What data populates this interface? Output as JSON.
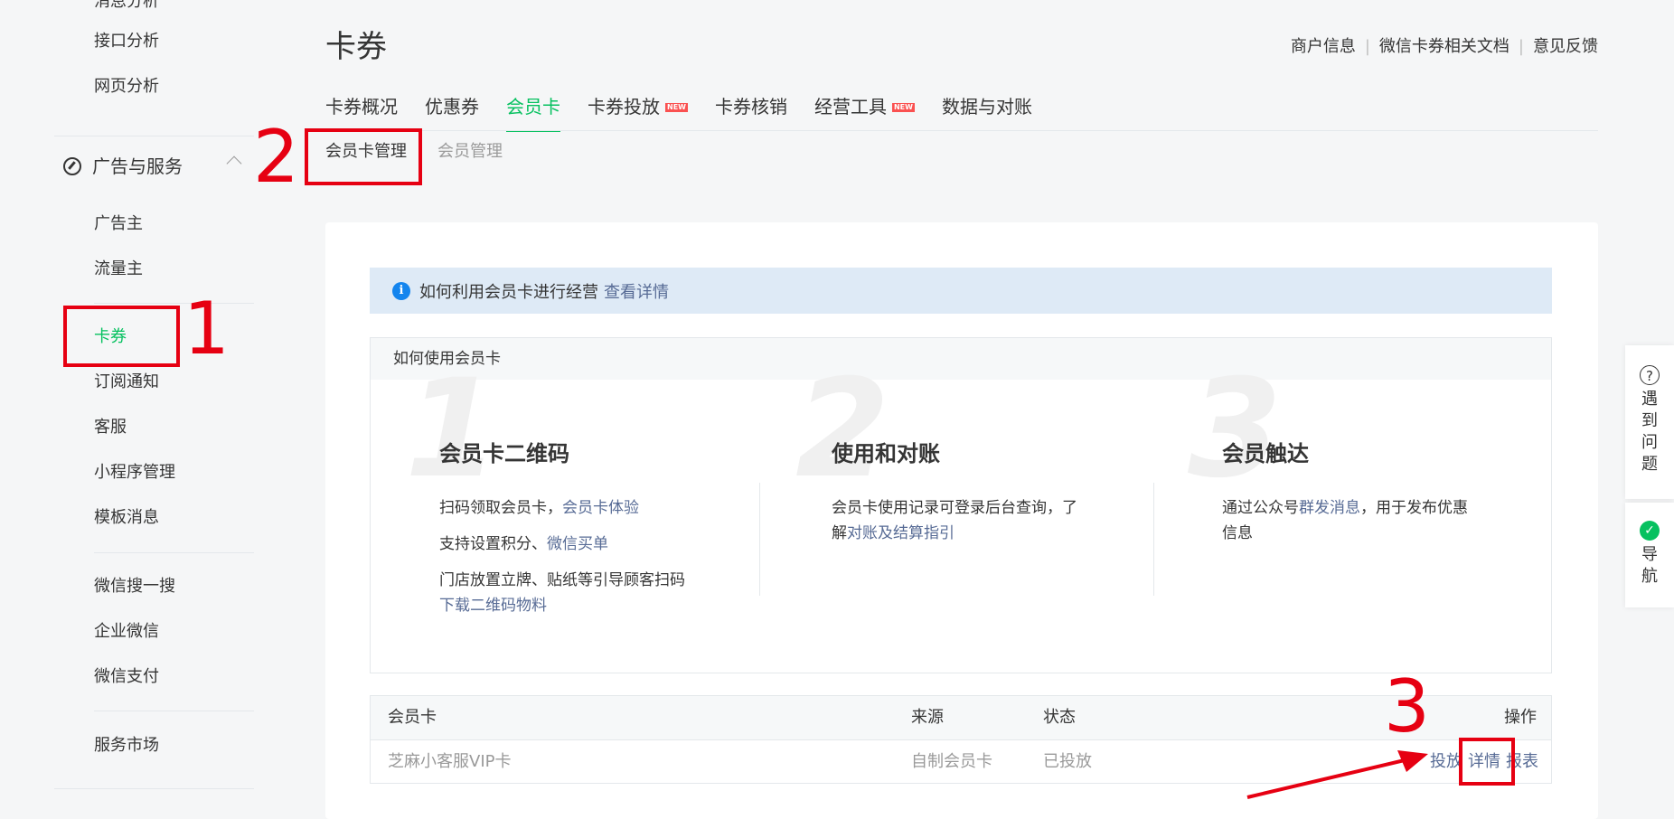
{
  "sidebar": {
    "top_items": [
      "消息分析",
      "接口分析",
      "网页分析"
    ],
    "section": {
      "title": "广告与服务",
      "icon": "compass-icon"
    },
    "group1": [
      "广告主",
      "流量主"
    ],
    "group2": [
      "卡券",
      "订阅通知",
      "客服",
      "小程序管理",
      "模板消息"
    ],
    "group3": [
      "微信搜一搜",
      "企业微信",
      "微信支付"
    ],
    "group4": [
      "服务市场"
    ]
  },
  "header": {
    "title": "卡券",
    "links": [
      "商户信息",
      "微信卡券相关文档",
      "意见反馈"
    ]
  },
  "tabs": [
    {
      "label": "卡券概况"
    },
    {
      "label": "优惠券"
    },
    {
      "label": "会员卡"
    },
    {
      "label": "卡券投放",
      "badge": "NEW"
    },
    {
      "label": "卡券核销"
    },
    {
      "label": "经营工具",
      "badge": "NEW"
    },
    {
      "label": "数据与对账"
    }
  ],
  "subtabs": [
    "会员卡管理",
    "会员管理"
  ],
  "info": {
    "text": "如何利用会员卡进行经营",
    "link": "查看详情"
  },
  "how": {
    "title": "如何使用会员卡",
    "steps": [
      {
        "num": "1",
        "title": "会员卡二维码",
        "l1": "扫码领取会员卡，",
        "l1_link": "会员卡体验",
        "l2": "支持设置积分、",
        "l2_link": "微信买单",
        "l3": "门店放置立牌、贴纸等引导顾客扫码",
        "l3_link": "下载二维码物料"
      },
      {
        "num": "2",
        "title": "使用和对账",
        "l1": "会员卡使用记录可登录后台查询，了",
        "l2": "解",
        "l2_link": "对账及结算指引"
      },
      {
        "num": "3",
        "title": "会员触达",
        "l1a": "通过公众号",
        "l1_link": "群发消息",
        "l1b": "，用于发布优惠",
        "l2": "信息"
      }
    ]
  },
  "table": {
    "headers": {
      "card": "会员卡",
      "source": "来源",
      "status": "状态",
      "actions": "操作"
    },
    "rows": [
      {
        "card": "芝麻小客服VIP卡",
        "source": "自制会员卡",
        "status": "已投放",
        "a1": "投放",
        "a2": "详情",
        "a3": "报表"
      }
    ]
  },
  "float": {
    "help": "遇到问题",
    "nav": "导航",
    "help_icon": "question-icon",
    "nav_icon": "nav-icon"
  },
  "annotations": [
    "1",
    "2",
    "3"
  ],
  "colors": {
    "accent": "#07c160",
    "link": "#576b95",
    "annotation": "#e60012",
    "info_bg": "#deeaf6"
  }
}
